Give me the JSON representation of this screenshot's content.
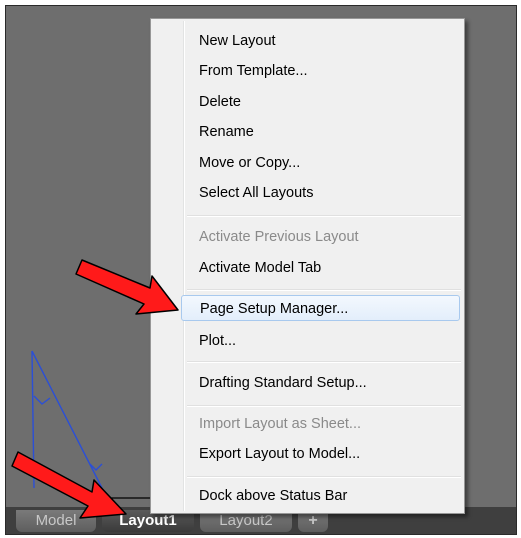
{
  "context_menu": {
    "items": [
      {
        "label": "New Layout",
        "enabled": true
      },
      {
        "label": "From Template...",
        "enabled": true
      },
      {
        "label": "Delete",
        "enabled": true
      },
      {
        "label": "Rename",
        "enabled": true
      },
      {
        "label": "Move or Copy...",
        "enabled": true
      },
      {
        "label": "Select All Layouts",
        "enabled": true
      },
      {
        "label": "Activate Previous Layout",
        "enabled": false
      },
      {
        "label": "Activate Model Tab",
        "enabled": true
      },
      {
        "label": "Page Setup Manager...",
        "enabled": true,
        "highlighted": true
      },
      {
        "label": "Plot...",
        "enabled": true
      },
      {
        "label": "Drafting Standard Setup...",
        "enabled": true
      },
      {
        "label": "Import Layout as Sheet...",
        "enabled": false
      },
      {
        "label": "Export Layout to Model...",
        "enabled": true
      },
      {
        "label": "Dock above Status Bar",
        "enabled": true
      }
    ]
  },
  "layout_tabs": {
    "model": "Model",
    "layout1": "Layout1",
    "layout2": "Layout2",
    "add": "+"
  },
  "annotations": {
    "arrow_color": "#ff0000",
    "arrow_icon": "red-arrow-icon"
  },
  "colors": {
    "canvas": "#6e6e6e",
    "menu_bg": "#f0f0f0",
    "menu_highlight_border": "#a8c9ee",
    "drawing_lines": "#2b4fd6"
  }
}
